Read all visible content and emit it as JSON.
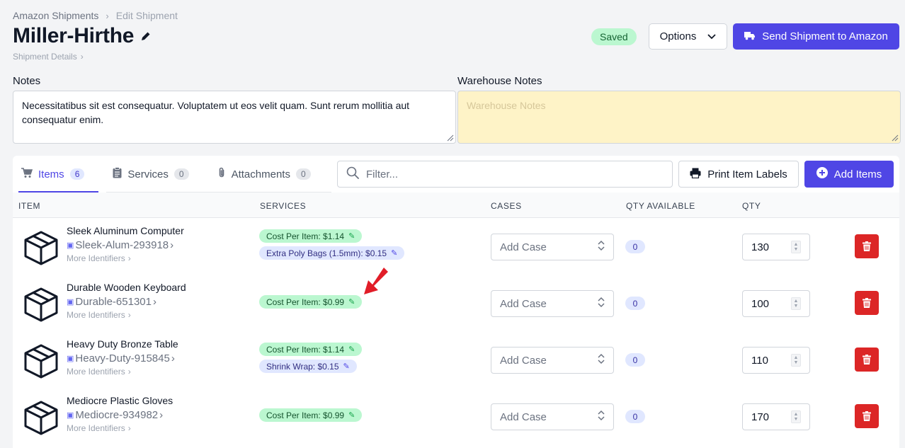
{
  "breadcrumb": {
    "root": "Amazon Shipments",
    "current": "Edit Shipment"
  },
  "page": {
    "title": "Miller-Hirthe",
    "subtitle": "Shipment Details"
  },
  "header": {
    "status": "Saved",
    "options_label": "Options",
    "send_label": "Send Shipment to Amazon"
  },
  "notes": {
    "label": "Notes",
    "value": "Necessitatibus sit est consequatur. Voluptatem ut eos velit quam. Sunt rerum mollitia aut consequatur enim.",
    "warehouse_label": "Warehouse Notes",
    "warehouse_placeholder": "Warehouse Notes"
  },
  "tabs": [
    {
      "label": "Items",
      "count": "6",
      "icon": "cart-icon"
    },
    {
      "label": "Services",
      "count": "0",
      "icon": "clipboard-icon"
    },
    {
      "label": "Attachments",
      "count": "0",
      "icon": "paperclip-icon"
    }
  ],
  "toolbar": {
    "filter_placeholder": "Filter...",
    "print_label": "Print Item Labels",
    "add_label": "Add Items"
  },
  "columns": {
    "item": "ITEM",
    "services": "SERVICES",
    "cases": "CASES",
    "qty_available": "QTY AVAILABLE",
    "qty": "QTY"
  },
  "rows": [
    {
      "name": "Sleek Aluminum Computer",
      "sku": "Sleek-Alum-293918",
      "more": "More Identifiers",
      "service1": "Cost Per Item: $1.14",
      "service2": "Extra Poly Bags (1.5mm): $0.15",
      "case_placeholder": "Add Case",
      "available": "0",
      "qty": "130"
    },
    {
      "name": "Durable Wooden Keyboard",
      "sku": "Durable-651301",
      "more": "More Identifiers",
      "service1": "Cost Per Item: $0.99",
      "case_placeholder": "Add Case",
      "available": "0",
      "qty": "100"
    },
    {
      "name": "Heavy Duty Bronze Table",
      "sku": "Heavy-Duty-915845",
      "more": "More Identifiers",
      "service1": "Cost Per Item: $1.14",
      "service2": "Shrink Wrap: $0.15",
      "case_placeholder": "Add Case",
      "available": "0",
      "qty": "110"
    },
    {
      "name": "Mediocre Plastic Gloves",
      "sku": "Mediocre-934982",
      "more": "More Identifiers",
      "service1": "Cost Per Item: $0.99",
      "case_placeholder": "Add Case",
      "available": "0",
      "qty": "170"
    }
  ],
  "colors": {
    "accent": "#4f46e5",
    "danger": "#dc2626",
    "success_bg": "#bbf7d0",
    "warehouse_bg": "#fef3c7",
    "annotation": "#e11d28"
  }
}
